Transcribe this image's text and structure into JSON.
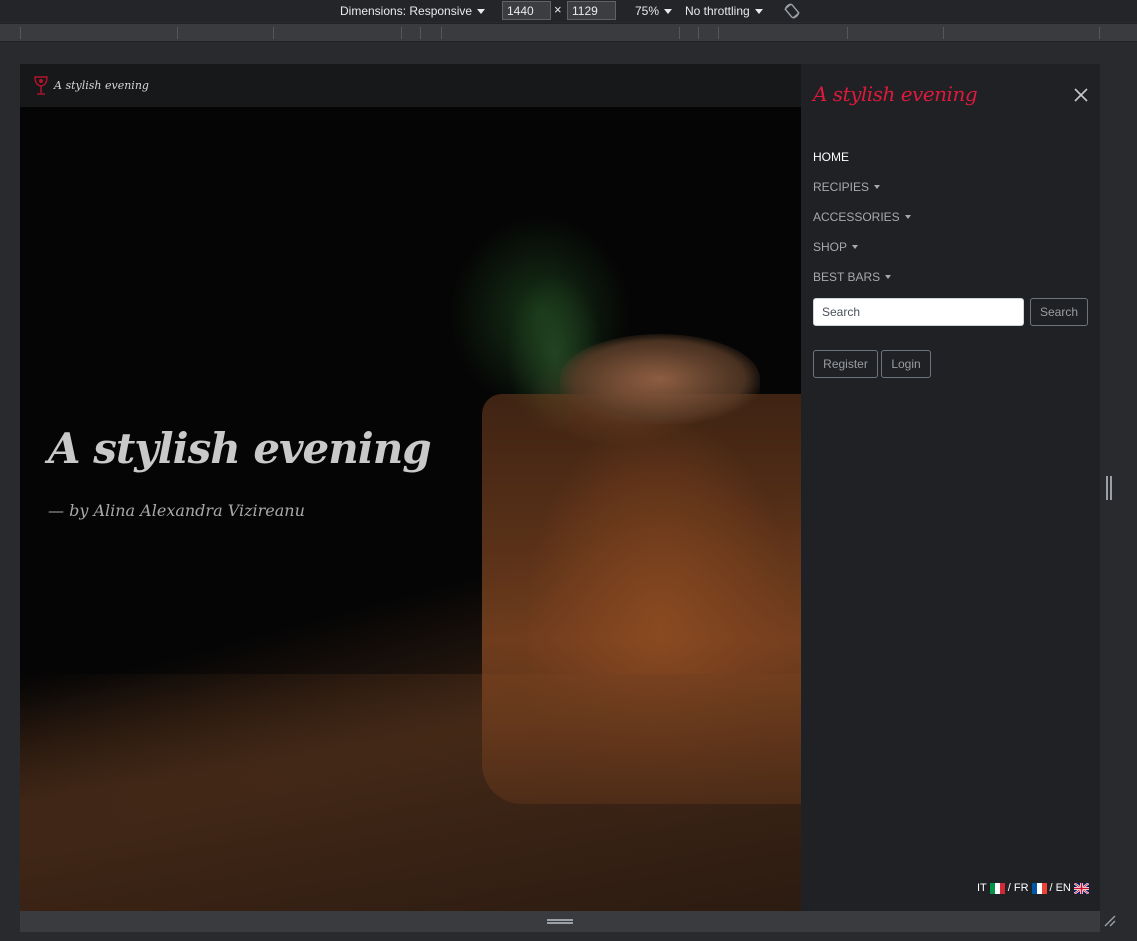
{
  "devtools": {
    "dimensions_label": "Dimensions: Responsive",
    "width_value": "1440",
    "height_value": "1129",
    "times_symbol": "×",
    "zoom_label": "75%",
    "throttling_label": "No throttling",
    "rotate_icon": "rotate-icon"
  },
  "site": {
    "brand_name": "A stylish evening",
    "brand_icon": "wine-glass-icon",
    "hero_title": "A stylish evening",
    "hero_subtitle": "— by Alina Alexandra Vizireanu"
  },
  "offcanvas": {
    "title": "A stylish evening",
    "close_icon": "close-icon",
    "nav_items": [
      {
        "label": "HOME",
        "active": true,
        "dropdown": false
      },
      {
        "label": "RECIPIES",
        "active": false,
        "dropdown": true
      },
      {
        "label": "ACCESSORIES",
        "active": false,
        "dropdown": true
      },
      {
        "label": "SHOP",
        "active": false,
        "dropdown": true
      },
      {
        "label": "BEST BARS",
        "active": false,
        "dropdown": true
      }
    ],
    "search_placeholder": "Search",
    "search_button": "Search",
    "register_button": "Register",
    "login_button": "Login"
  },
  "languages": {
    "it": "IT",
    "sep1": " / ",
    "fr": "FR",
    "sep2": " / ",
    "en": "EN"
  },
  "colors": {
    "accent": "#dc1a3b",
    "offcanvas_bg": "#1f2124"
  }
}
